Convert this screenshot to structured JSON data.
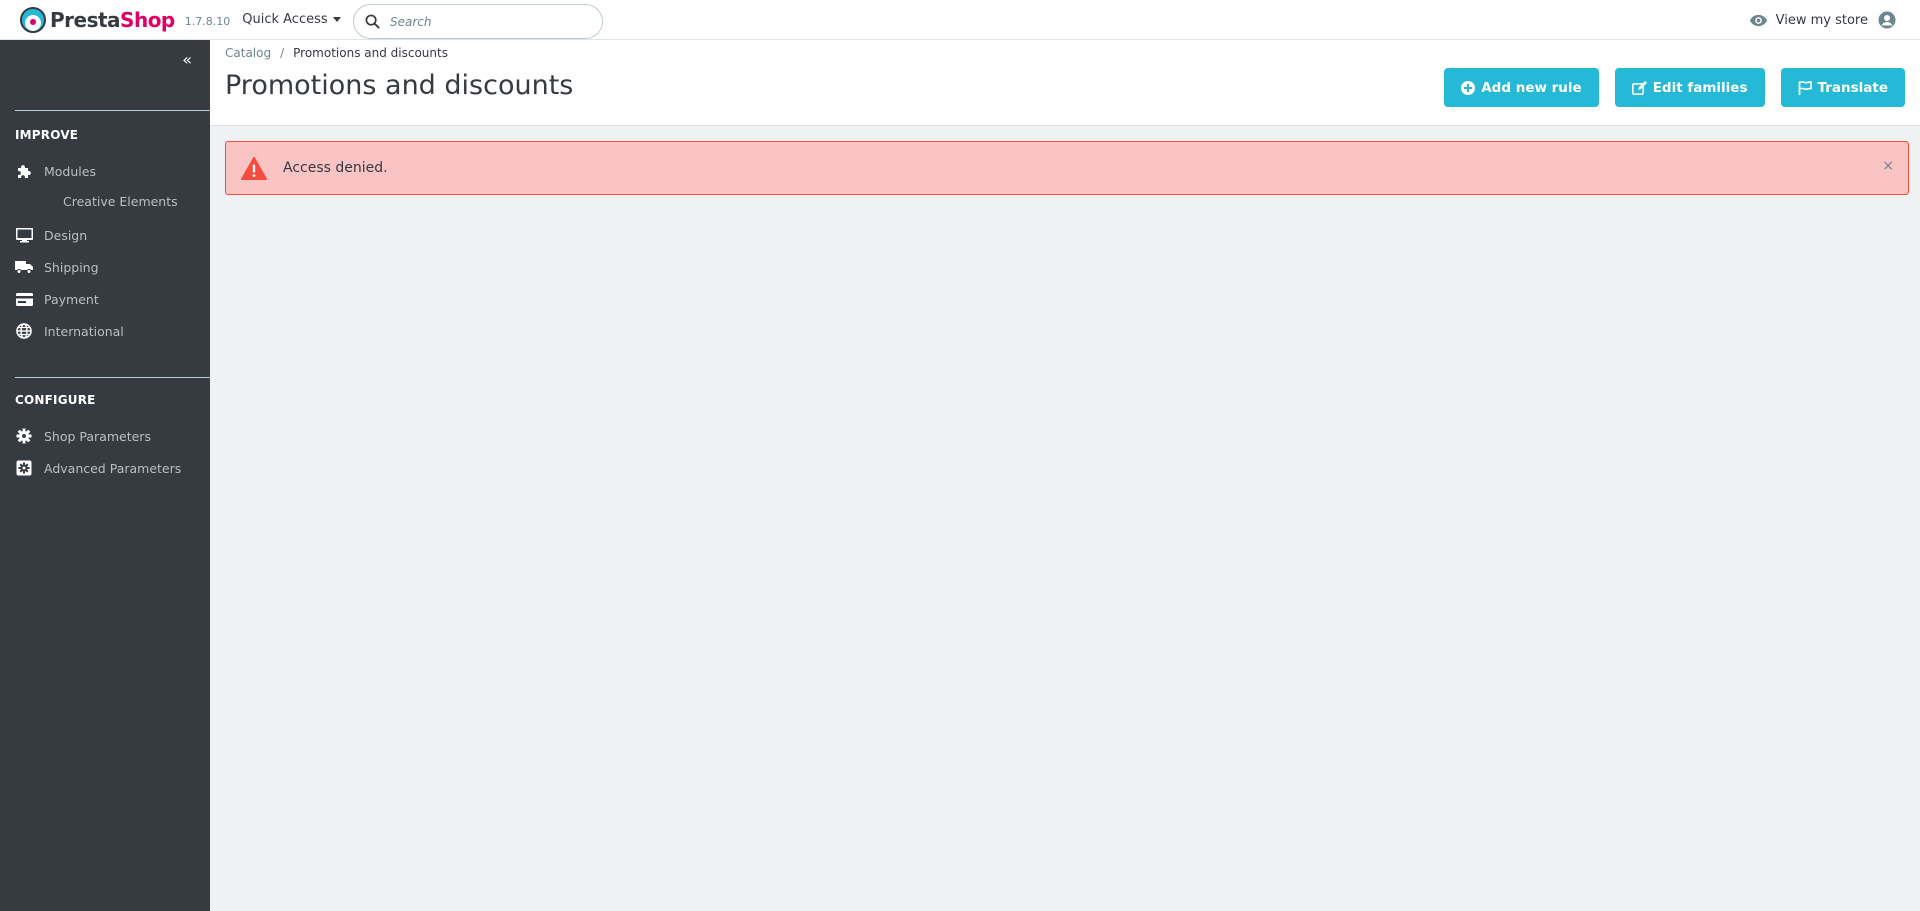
{
  "header": {
    "logo_left": "Presta",
    "logo_right": "Shop",
    "version": "1.7.8.10",
    "quick_access_label": "Quick Access",
    "search_placeholder": "Search",
    "view_store_label": "View my store"
  },
  "sidebar": {
    "collapse_icon": "«",
    "sections": [
      {
        "title": "IMPROVE",
        "items": [
          {
            "label": "Modules",
            "icon": "puzzle-icon"
          },
          {
            "label": "Creative Elements",
            "sub": true
          },
          {
            "label": "Design",
            "icon": "desktop-icon"
          },
          {
            "label": "Shipping",
            "icon": "truck-icon"
          },
          {
            "label": "Payment",
            "icon": "credit-card-icon"
          },
          {
            "label": "International",
            "icon": "globe-icon"
          }
        ]
      },
      {
        "title": "CONFIGURE",
        "items": [
          {
            "label": "Shop Parameters",
            "icon": "gear-icon"
          },
          {
            "label": "Advanced Parameters",
            "icon": "advanced-gear-icon"
          }
        ]
      }
    ]
  },
  "page": {
    "breadcrumb": [
      "Catalog",
      "Promotions and discounts"
    ],
    "breadcrumb_separator": "/",
    "title": "Promotions and discounts",
    "buttons": [
      {
        "label": "Add new rule",
        "icon": "plus-circle-icon"
      },
      {
        "label": "Edit families",
        "icon": "edit-icon"
      },
      {
        "label": "Translate",
        "icon": "flag-icon"
      }
    ]
  },
  "alert": {
    "message": "Access denied.",
    "close_symbol": "×",
    "icon": "warning-icon"
  },
  "colors": {
    "accent": "#25b9d7",
    "sidebar_bg": "#363a41",
    "alert_bg": "#f9c4c3",
    "alert_border": "#f54c3e",
    "logo_pink": "#df0067",
    "page_bg": "#eff1f2"
  }
}
